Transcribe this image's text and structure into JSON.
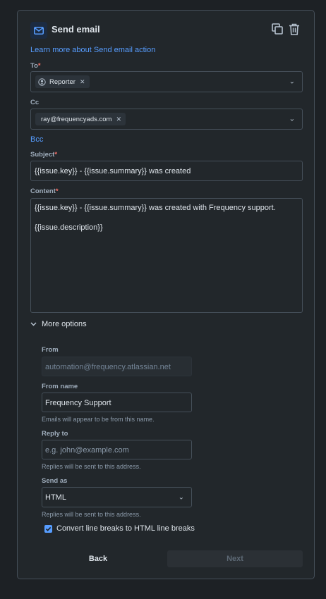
{
  "header": {
    "title": "Send email"
  },
  "learn_more_link": "Learn more about Send email action",
  "to": {
    "label": "To",
    "required_mark": "*",
    "chips": [
      {
        "label": "Reporter"
      }
    ]
  },
  "cc": {
    "label": "Cc",
    "chips": [
      {
        "label": "ray@frequencyads.com"
      }
    ]
  },
  "bcc_link": "Bcc",
  "subject": {
    "label": "Subject",
    "required_mark": "*",
    "value": "{{issue.key}} - {{issue.summary}} was created"
  },
  "content": {
    "label": "Content",
    "required_mark": "*",
    "line1": "{{issue.key}}  - {{issue.summary}} was created with Frequency support.",
    "line2": "{{issue.description}}"
  },
  "more_options": {
    "label": "More options"
  },
  "from": {
    "label": "From",
    "value": "automation@frequency.atlassian.net"
  },
  "from_name": {
    "label": "From name",
    "value": "Frequency Support",
    "help": "Emails will appear to be from this name."
  },
  "reply_to": {
    "label": "Reply to",
    "placeholder": "e.g. john@example.com",
    "help": "Replies will be sent to this address."
  },
  "send_as": {
    "label": "Send as",
    "value": "HTML",
    "help": "Replies will be sent to this address."
  },
  "convert_line_breaks": {
    "label": "Convert line breaks to HTML line breaks",
    "checked": true
  },
  "footer": {
    "back_label": "Back",
    "next_label": "Next"
  },
  "colors": {
    "accent": "#579dff",
    "required": "#f87168",
    "checkbox": "#579dff"
  }
}
